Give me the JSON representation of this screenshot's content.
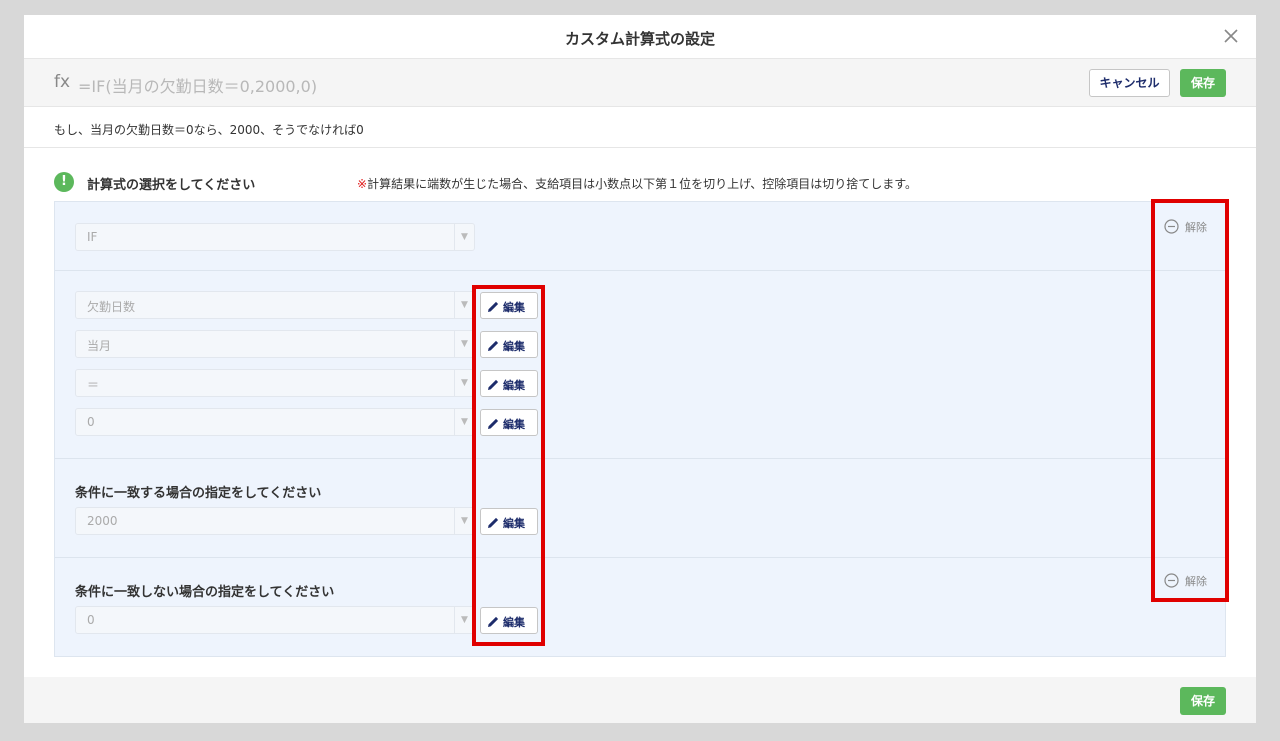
{
  "modal": {
    "title": "カスタム計算式の設定",
    "close_icon": "close-icon"
  },
  "formula_bar": {
    "fx": "fx",
    "formula": "=IF(当月の欠勤日数＝0,2000,0)",
    "cancel_label": "キャンセル",
    "save_label": "保存"
  },
  "description": "もし、当月の欠勤日数＝0なら、2000、そうでなければ0",
  "select_section": {
    "icon": "!",
    "title": "計算式の選択をしてください",
    "note_mark": "※",
    "note": "計算結果に端数が生じた場合、支給項目は小数点以下第１位を切り上げ、控除項目は切り捨てします。"
  },
  "function_select": {
    "value": "IF"
  },
  "remove_label": "解除",
  "edit_label": "編集",
  "condition_fields": [
    {
      "value": "欠勤日数"
    },
    {
      "value": "当月"
    },
    {
      "value": "＝"
    },
    {
      "value": "0"
    }
  ],
  "true_section": {
    "label": "条件に一致する場合の指定をしてください",
    "value": "2000"
  },
  "false_section": {
    "label": "条件に一致しない場合の指定をしてください",
    "value": "0"
  },
  "footer": {
    "save_label": "保存"
  },
  "colors": {
    "accent_green": "#5cb85c",
    "highlight_red": "#e00000",
    "panel_bg": "#eef4fd",
    "button_text_navy": "#1d2c6b"
  }
}
